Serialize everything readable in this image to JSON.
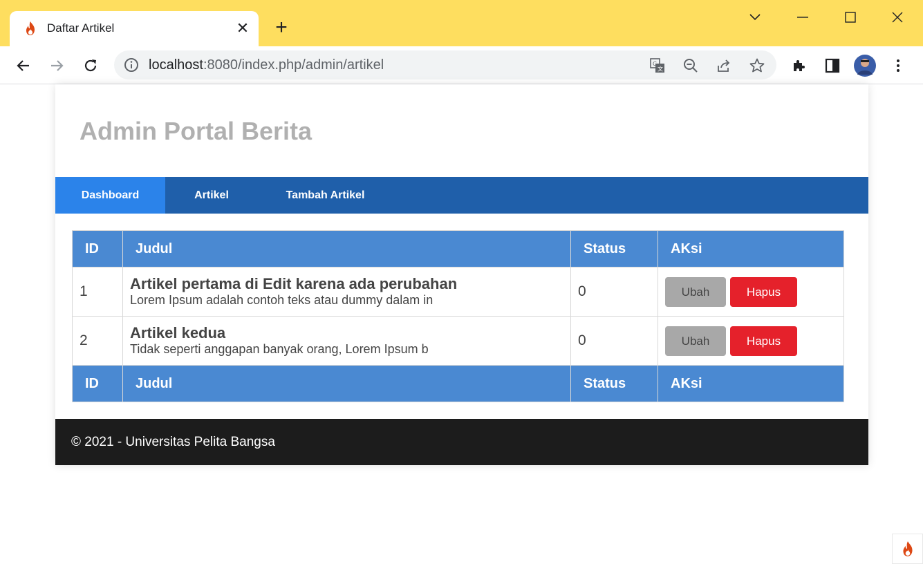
{
  "browser": {
    "tab_title": "Daftar Artikel",
    "new_tab_label": "+",
    "url_host": "localhost",
    "url_path": ":8080/index.php/admin/artikel"
  },
  "page": {
    "site_title": "Admin Portal Berita",
    "nav": [
      {
        "label": "Dashboard",
        "active": true
      },
      {
        "label": "Artikel",
        "active": false
      },
      {
        "label": "Tambah Artikel",
        "active": false
      }
    ],
    "table": {
      "headers": [
        "ID",
        "Judul",
        "Status",
        "AKsi"
      ],
      "rows": [
        {
          "id": "1",
          "judul": "Artikel pertama di Edit karena ada perubahan",
          "excerpt": "Lorem Ipsum adalah contoh teks atau dummy dalam in",
          "status": "0",
          "ubah": "Ubah",
          "hapus": "Hapus"
        },
        {
          "id": "2",
          "judul": "Artikel kedua",
          "excerpt": "Tidak seperti anggapan banyak orang, Lorem Ipsum b",
          "status": "0",
          "ubah": "Ubah",
          "hapus": "Hapus"
        }
      ]
    },
    "footer": "© 2021 - Universitas Pelita Bangsa"
  },
  "colors": {
    "titlebar": "#fede5f",
    "nav": "#1f5faa",
    "nav_active": "#2b83ea",
    "table_header": "#4a89d2",
    "hapus": "#e5212b",
    "ubah": "#a8a8a8",
    "footer": "#1c1c1c"
  }
}
